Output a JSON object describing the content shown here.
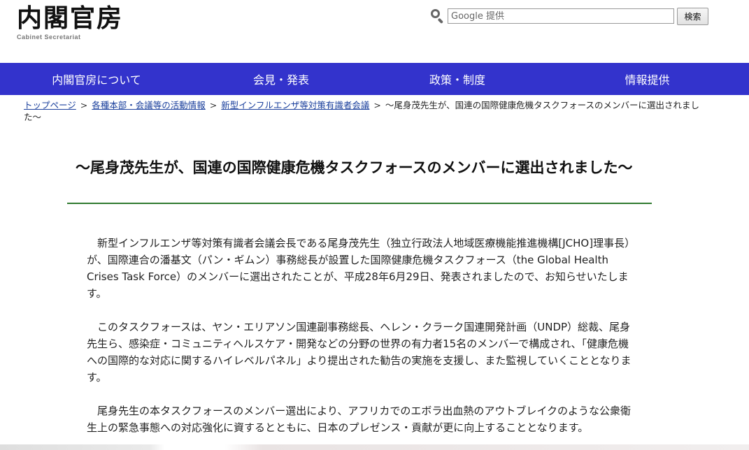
{
  "header": {
    "logo_main": "内閣官房",
    "logo_sub": "Cabinet Secretariat",
    "search": {
      "placeholder": "Google 提供",
      "button_label": "検索"
    }
  },
  "nav": {
    "items": [
      {
        "label": "内閣官房について"
      },
      {
        "label": "会見・発表"
      },
      {
        "label": "政策・制度"
      },
      {
        "label": "情報提供"
      }
    ]
  },
  "breadcrumb": {
    "items": [
      {
        "label": "トップページ"
      },
      {
        "label": "各種本部・会議等の活動情報"
      },
      {
        "label": "新型インフルエンザ等対策有識者会議"
      }
    ],
    "separator": ">",
    "current": "～尾身茂先生が、国連の国際健康危機タスクフォースのメンバーに選出されました～"
  },
  "article": {
    "title": "～尾身茂先生が、国連の国際健康危機タスクフォースのメンバーに選出されました～",
    "paragraphs": [
      "新型インフルエンザ等対策有識者会議会長である尾身茂先生（独立行政法人地域医療機能推進機構[JCHO]理事長）が、国際連合の潘基文（パン・ギムン）事務総長が設置した国際健康危機タスクフォース（the Global Health Crises Task Force）のメンバーに選出されたことが、平成28年6月29日、発表されましたので、お知らせいたします。",
      "このタスクフォースは、ヤン・エリアソン国連副事務総長、ヘレン・クラーク国連開発計画（UNDP）総裁、尾身先生ら、感染症・コミュニティヘルスケア・開発などの分野の世界の有力者15名のメンバーで構成され、「健康危機への国際的な対応に関するハイレベルパネル」より提出された勧告の実施を支援し、また監視していくこととなります。",
      "尾身先生の本タスクフォースのメンバー選出により、アフリカでのエボラ出血熱のアウトブレイクのような公衆衛生上の緊急事態への対応強化に資するとともに、日本のプレゼンス・貢献が更に向上することとなります。"
    ]
  }
}
